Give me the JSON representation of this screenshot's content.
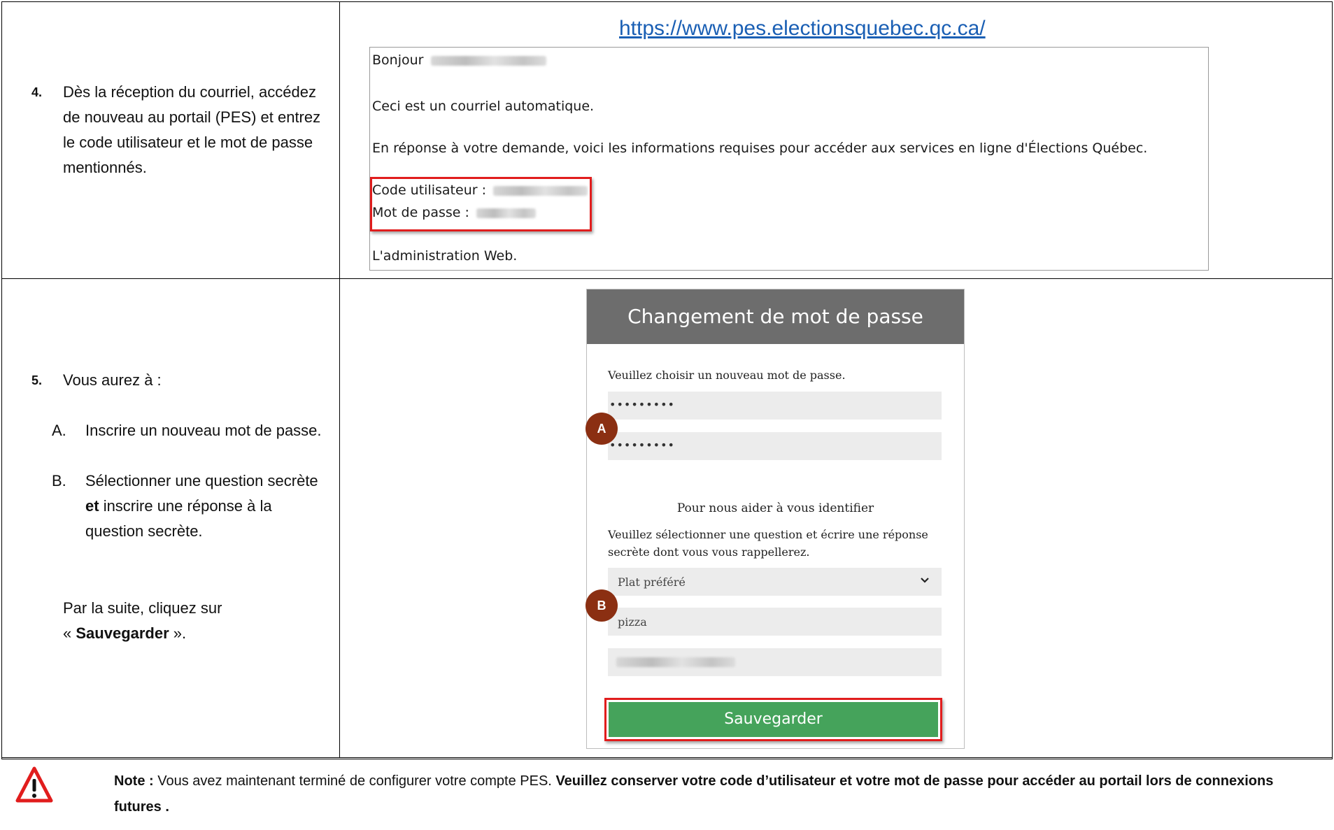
{
  "step4": {
    "number": "4.",
    "text": "Dès la réception du courriel, accédez de nouveau au portail (PES) et entrez le code utilisateur et le mot de passe mentionnés."
  },
  "email": {
    "url": "https://www.pes.electionsquebec.qc.ca/",
    "greeting": "Bonjour",
    "automatic": "Ceci est un courriel automatique.",
    "response": "En réponse à votre demande, voici les informations requises pour accéder aux services en ligne d'Élections Québec.",
    "code_label": "Code utilisateur :",
    "password_label": "Mot de passe :",
    "signature": "L'administration Web."
  },
  "step5": {
    "number": "5.",
    "intro": "Vous aurez à :",
    "item_a_letter": "A.",
    "item_a_text": "Inscrire un nouveau mot de passe.",
    "item_b_letter": "B.",
    "item_b_pre": "Sélectionner une question secrète",
    "item_b_bold": "et",
    "item_b_post": "inscrire une réponse à la question secrète.",
    "outro_pre": "Par la suite, cliquez sur",
    "outro_quote_open": "«",
    "outro_bold": "Sauvegarder",
    "outro_quote_close": "»."
  },
  "form": {
    "title": "Changement de mot de passe",
    "choose_prompt": "Veuillez choisir un nouveau mot de passe.",
    "password_mask": "•••••••••",
    "confirm_mask": "•••••••••",
    "help_heading": "Pour nous aider à vous identifier",
    "help_text_1": "Veuillez sélectionner une question et écrire une réponse",
    "help_text_2": "secrète dont vous vous rappellerez.",
    "question_selected": "Plat préféré",
    "answer_value": "pizza",
    "save_label": "Sauvegarder",
    "marker_a": "A",
    "marker_b": "B"
  },
  "note": {
    "label": "Note :",
    "text": "Vous avez maintenant terminé de configurer votre compte PES.",
    "bold": "Veuillez conserver votre code d’utilisateur et votre mot de passe pour accéder au portail lors de connexions futures ."
  },
  "colors": {
    "link": "#1a5fb4",
    "highlight_red": "#e11d1d",
    "save_green": "#45a35b",
    "marker_brown": "#8b2f12",
    "header_gray": "#6d6d6d"
  },
  "icons": [
    "warning-icon",
    "chevron-down-icon"
  ]
}
